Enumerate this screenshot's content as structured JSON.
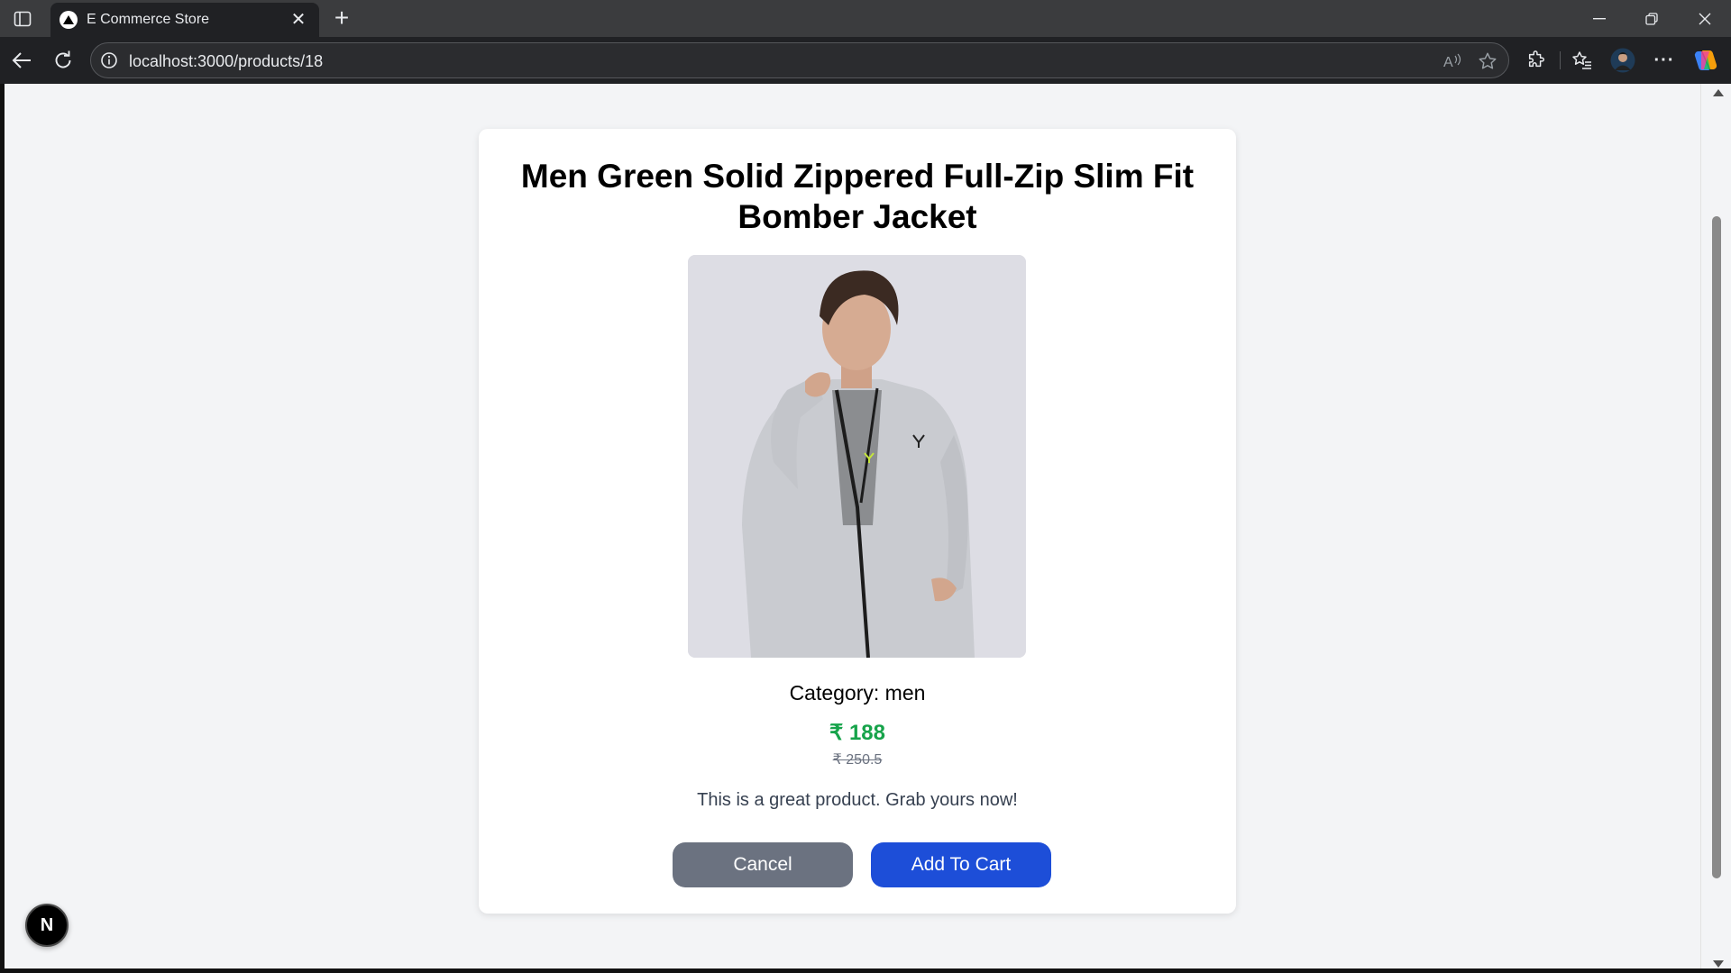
{
  "browser": {
    "tab_title": "E Commerce Store",
    "tab_close_glyph": "✕",
    "new_tab_glyph": "+",
    "url": "localhost:3000/products/18",
    "more_glyph": "···"
  },
  "product": {
    "title": "Men Green Solid Zippered Full-Zip Slim Fit Bomber Jacket",
    "category_label": "Category: men",
    "price": "₹ 188",
    "mrp": "₹ 250.5",
    "description": "This is a great product. Grab yours now!"
  },
  "actions": {
    "cancel_label": "Cancel",
    "add_to_cart_label": "Add To Cart"
  },
  "dev_badge": {
    "label": "N"
  },
  "colors": {
    "price": "#16a34a",
    "cancel_button": "#6b7280",
    "cart_button": "#1d4ed8",
    "page_background": "#f3f4f6"
  }
}
